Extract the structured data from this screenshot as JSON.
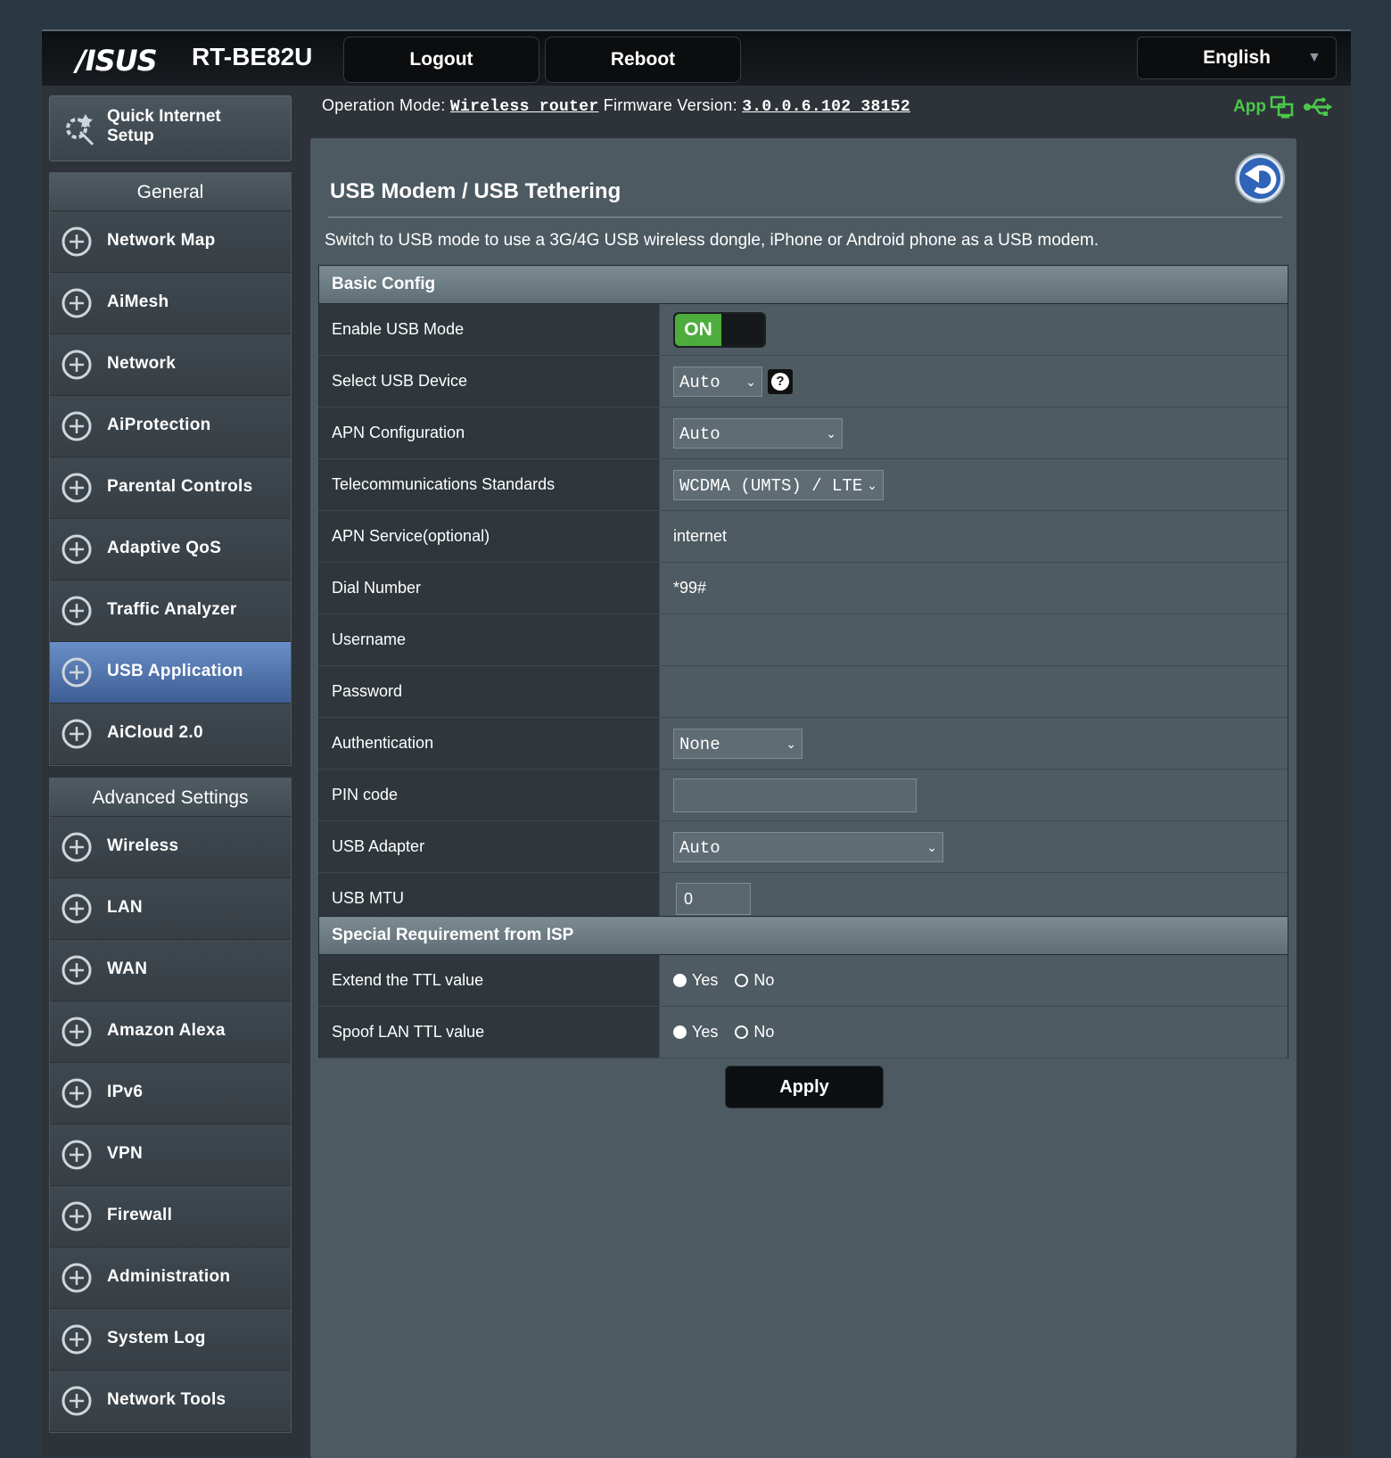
{
  "header": {
    "brand": "/ISUS",
    "model": "RT-BE82U",
    "logout_label": "Logout",
    "reboot_label": "Reboot",
    "language": "English"
  },
  "info": {
    "op_mode_label": "Operation Mode:",
    "op_mode_value": "Wireless router",
    "fw_label": "Firmware Version:",
    "fw_value": "3.0.0.6.102_38152",
    "app_label": "App"
  },
  "sidebar": {
    "quick_setup": "Quick Internet Setup",
    "general_title": "General",
    "general_items": [
      {
        "label": "Network Map",
        "icon": "network-map-icon"
      },
      {
        "label": "AiMesh",
        "icon": "aimesh-icon"
      },
      {
        "label": "Network",
        "icon": "network-icon"
      },
      {
        "label": "AiProtection",
        "icon": "shield-icon"
      },
      {
        "label": "Parental Controls",
        "icon": "family-icon"
      },
      {
        "label": "Adaptive QoS",
        "icon": "gauge-icon"
      },
      {
        "label": "Traffic Analyzer",
        "icon": "analyzer-icon"
      },
      {
        "label": "USB Application",
        "icon": "usb-icon",
        "active": true
      },
      {
        "label": "AiCloud 2.0",
        "icon": "cloud-icon"
      }
    ],
    "advanced_title": "Advanced Settings",
    "advanced_items": [
      {
        "label": "Wireless",
        "icon": "wifi-icon"
      },
      {
        "label": "LAN",
        "icon": "lan-icon"
      },
      {
        "label": "WAN",
        "icon": "globe-icon"
      },
      {
        "label": "Amazon Alexa",
        "icon": "alexa-icon"
      },
      {
        "label": "IPv6",
        "icon": "ipv6-icon"
      },
      {
        "label": "VPN",
        "icon": "vpn-icon"
      },
      {
        "label": "Firewall",
        "icon": "firewall-icon"
      },
      {
        "label": "Administration",
        "icon": "gear-icon"
      },
      {
        "label": "System Log",
        "icon": "log-icon"
      },
      {
        "label": "Network Tools",
        "icon": "tools-icon"
      }
    ]
  },
  "main": {
    "title": "USB Modem / USB Tethering",
    "description": "Switch to USB mode to use a 3G/4G USB wireless dongle, iPhone or Android phone as a USB modem.",
    "basic_config_title": "Basic Config",
    "enable_usb_label": "Enable USB Mode",
    "enable_usb_state": "ON",
    "select_device_label": "Select USB Device",
    "select_device_value": "Auto",
    "apn_config_label": "APN Configuration",
    "apn_config_value": "Auto",
    "telecom_label": "Telecommunications Standards",
    "telecom_value": "WCDMA (UMTS) / LTE",
    "apn_service_label": "APN Service(optional)",
    "apn_service_value": "internet",
    "dial_label": "Dial Number",
    "dial_value": "*99#",
    "username_label": "Username",
    "username_value": "",
    "password_label": "Password",
    "password_value": "",
    "auth_label": "Authentication",
    "auth_value": "None",
    "pin_label": "PIN code",
    "pin_value": "",
    "adapter_label": "USB Adapter",
    "adapter_value": "Auto",
    "mtu_label": "USB MTU",
    "mtu_value": "0",
    "isp_title": "Special Requirement from ISP",
    "ttl_label": "Extend the TTL value",
    "spoof_label": "Spoof LAN TTL value",
    "yes_label": "Yes",
    "no_label": "No",
    "apply_label": "Apply"
  },
  "colors": {
    "accent_green": "#4cac3c",
    "active_menu": "#4f74b0",
    "app_green": "#4bc84b"
  }
}
